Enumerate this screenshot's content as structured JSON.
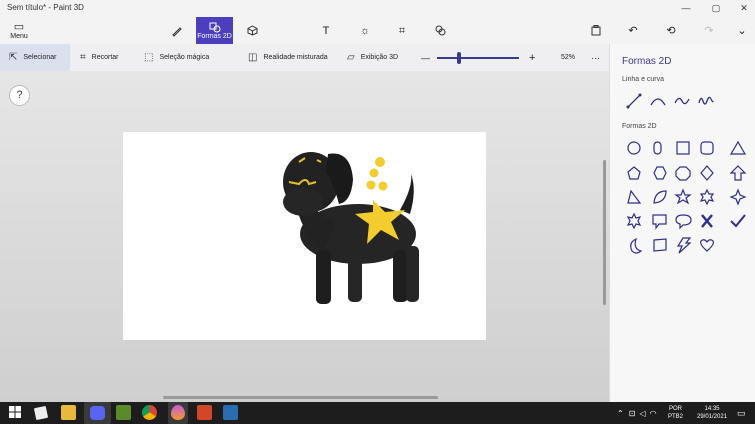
{
  "window": {
    "title": "Sem título* - Paint 3D",
    "minimize_icon": "minimize-icon",
    "maximize_icon": "maximize-icon",
    "close_icon": "close-icon"
  },
  "toolbar": {
    "menu_label": "Menu",
    "active_label": "Formas 2D",
    "accent": "#4b3fbd"
  },
  "cmdbar": {
    "select": "Selecionar",
    "crop": "Recortar",
    "magic_select": "Seleção mágica",
    "mixed_reality": "Realidade misturada",
    "view_3d": "Exibição 3D",
    "zoom_minus": "—",
    "zoom_plus": "+",
    "zoom_level": "52%",
    "zoom_fraction": 0.52,
    "more": "···"
  },
  "help": {
    "label": "?"
  },
  "panel": {
    "title": "Formas 2D",
    "lines_section": "Linha e curva",
    "shapes_section": "Formas 2D"
  },
  "taskbar": {
    "lang_top": "POR",
    "lang_bottom": "PTB2",
    "time": "14:35",
    "date": "29/01/2021"
  }
}
